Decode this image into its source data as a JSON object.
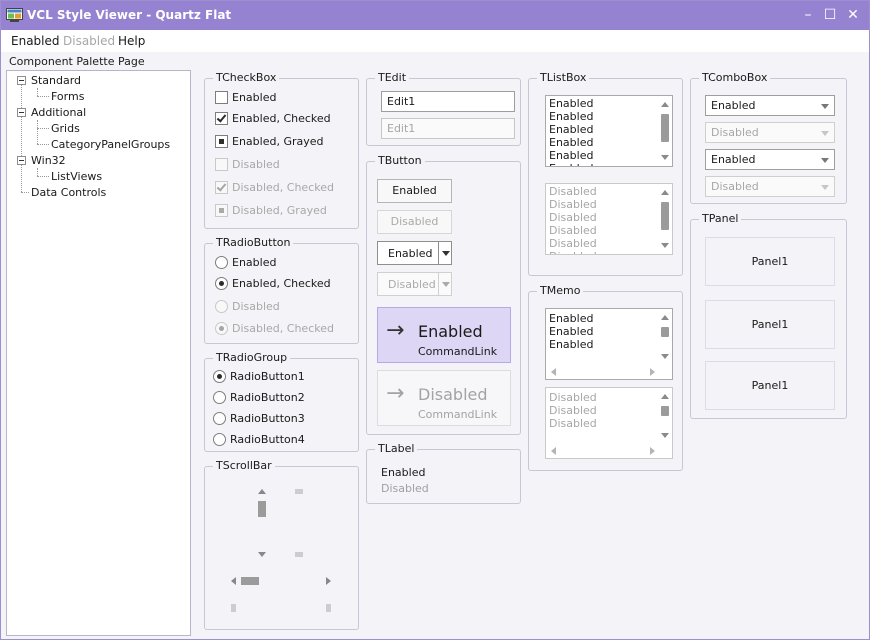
{
  "window": {
    "title": "VCL Style Viewer - Quartz Flat",
    "icon": "app-window-icon",
    "minimize": "–",
    "maximize": "☐",
    "close": "✕"
  },
  "menu": {
    "enabled": "Enabled",
    "disabled": "Disabled",
    "help": "Help"
  },
  "palette": {
    "label": "Component Palette Page",
    "tree": {
      "standard": "Standard",
      "forms": "Forms",
      "additional": "Additional",
      "grids": "Grids",
      "category": "CategoryPanelGroups",
      "win32": "Win32",
      "listviews": "ListViews",
      "data": "Data Controls"
    }
  },
  "checkbox": {
    "title": "TCheckBox",
    "items": [
      "Enabled",
      "Enabled, Checked",
      "Enabled, Grayed",
      "Disabled",
      "Disabled, Checked",
      "Disabled, Grayed"
    ]
  },
  "radio": {
    "title": "TRadioButton",
    "items": [
      "Enabled",
      "Enabled, Checked",
      "Disabled",
      "Disabled, Checked"
    ]
  },
  "radiogroup": {
    "title": "TRadioGroup",
    "items": [
      "RadioButton1",
      "RadioButton2",
      "RadioButton3",
      "RadioButton4"
    ]
  },
  "scrollbar": {
    "title": "TScrollBar"
  },
  "edit": {
    "title": "TEdit",
    "enabled": "Edit1",
    "disabled": "Edit1"
  },
  "button": {
    "title": "TButton",
    "enabled": "Enabled",
    "disabled": "Disabled",
    "split_enabled": "Enabled",
    "split_disabled": "Disabled",
    "cmd_enabled": "Enabled",
    "cmd_enabled_sub": "CommandLink",
    "cmd_arrow": "→",
    "cmd_disabled": "Disabled",
    "cmd_disabled_sub": "CommandLink"
  },
  "label": {
    "title": "TLabel",
    "enabled": "Enabled",
    "disabled": "Disabled"
  },
  "listbox": {
    "title": "TListBox",
    "enabled_items": "Enabled\nEnabled\nEnabled\nEnabled\nEnabled\nEnabled",
    "disabled_items": "Disabled\nDisabled\nDisabled\nDisabled\nDisabled\nDisabled"
  },
  "memo": {
    "title": "TMemo",
    "enabled_items": "Enabled\nEnabled\nEnabled",
    "disabled_items": "Disabled\nDisabled\nDisabled"
  },
  "combobox": {
    "title": "TComboBox",
    "items": [
      "Enabled",
      "Disabled",
      "Enabled",
      "Disabled"
    ]
  },
  "panel": {
    "title": "TPanel",
    "items": [
      "Panel1",
      "Panel1",
      "Panel1"
    ]
  },
  "colors": {
    "titlebar": "#9582d0",
    "cmd_bg": "#ddd6f4",
    "border": "#cac6d6"
  }
}
